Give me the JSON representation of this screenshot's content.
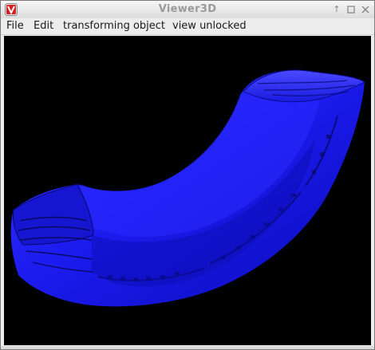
{
  "window": {
    "title": "Viewer3D",
    "controls": [
      "pin-icon",
      "maximize-icon",
      "close-icon"
    ]
  },
  "menu": {
    "items": [
      {
        "label": "File"
      },
      {
        "label": "Edit"
      },
      {
        "label": "transforming object"
      },
      {
        "label": "view unlocked"
      }
    ]
  },
  "viewport": {
    "background": "#000000",
    "object_color": "#1a1aff",
    "object": "tire-segment-3d-model"
  }
}
